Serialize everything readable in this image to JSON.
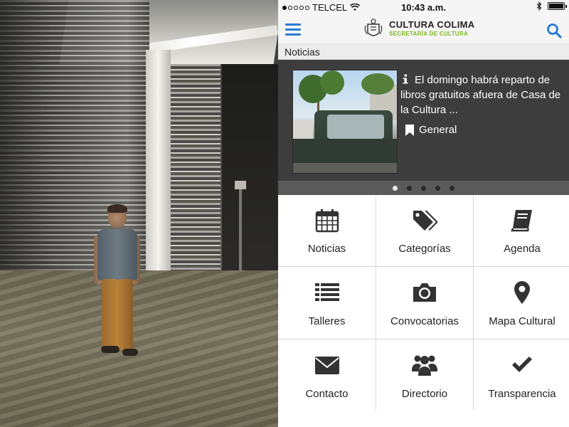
{
  "statusbar": {
    "carrier": "TELCEL",
    "time": "10:43 a.m.",
    "signal_bars_filled": 1,
    "battery_level": 1.0
  },
  "appbar": {
    "brand_title": "CULTURA COLIMA",
    "brand_subtitle": "SECRETARÍA DE CULTURA",
    "menu_icon": "hamburger-icon",
    "search_icon": "search-icon"
  },
  "section": {
    "title": "Noticias"
  },
  "carousel": {
    "headline": "El domingo habrá reparto de libros gratuitos afuera de Casa de la Cultura ...",
    "category": "General",
    "slide_count": 5,
    "active_slide": 1
  },
  "tiles": [
    {
      "label": "Noticias",
      "icon": "calendar-icon"
    },
    {
      "label": "Categorías",
      "icon": "tags-icon"
    },
    {
      "label": "Agenda",
      "icon": "book-icon"
    },
    {
      "label": "Talleres",
      "icon": "list-icon"
    },
    {
      "label": "Convocatorias",
      "icon": "camera-icon"
    },
    {
      "label": "Mapa Cultural",
      "icon": "map-marker-icon"
    },
    {
      "label": "Contacto",
      "icon": "envelope-icon"
    },
    {
      "label": "Directorio",
      "icon": "users-icon"
    },
    {
      "label": "Transparencia",
      "icon": "check-icon"
    }
  ],
  "colors": {
    "accent_blue": "#2b7bd4",
    "brand_green": "#7cb51e",
    "icon_dark": "#333333",
    "carousel_bg": "#3d3d3d"
  }
}
